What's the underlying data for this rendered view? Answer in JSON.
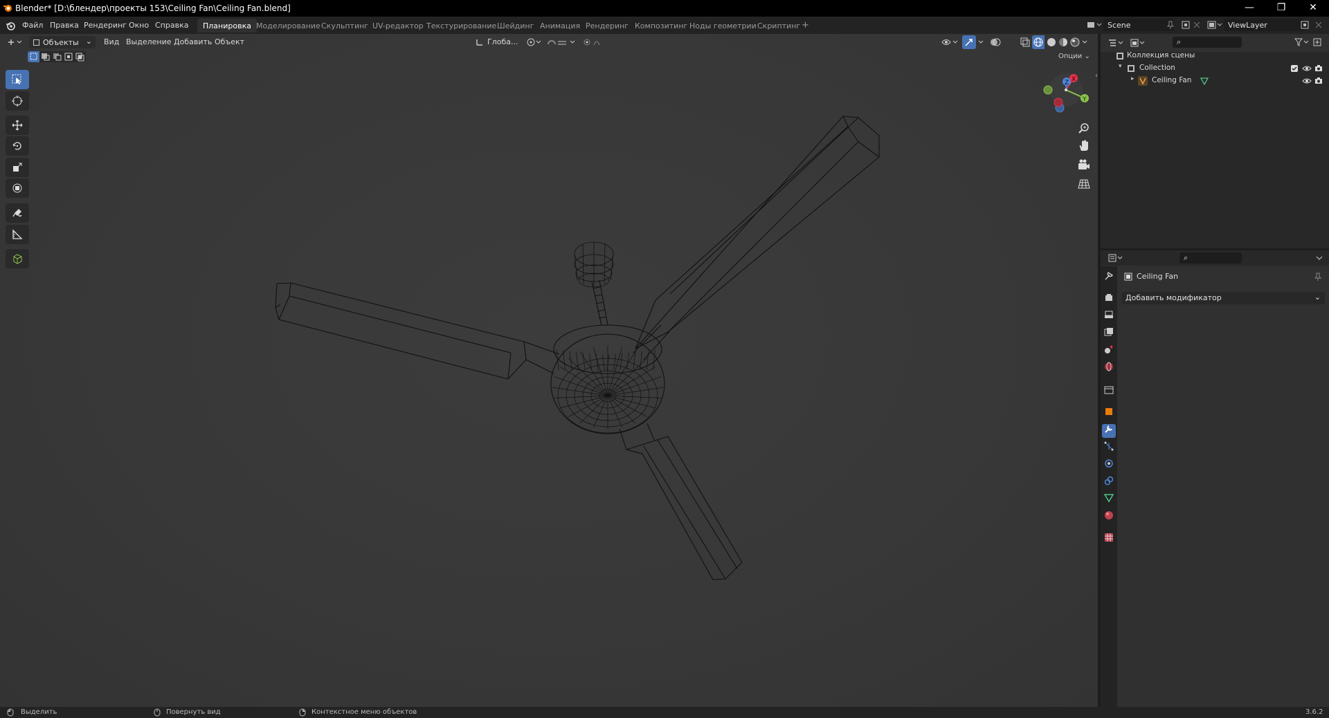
{
  "window": {
    "title": "Blender* [D:\\блендер\\проекты 153\\Ceiling Fan\\Ceiling Fan.blend]",
    "minimize": "—",
    "maximize": "❐",
    "close": "✕"
  },
  "menu": {
    "items": [
      "Файл",
      "Правка",
      "Рендеринг",
      "Окно",
      "Справка"
    ]
  },
  "workspaces": {
    "tabs": [
      "Планировка",
      "Моделирование",
      "Скульптинг",
      "UV-редактор",
      "Текстурирование",
      "Шейдинг",
      "Анимация",
      "Рендеринг",
      "Композитинг",
      "Ноды геометрии",
      "Скриптинг"
    ],
    "active": "Планировка",
    "add": "+"
  },
  "scene": {
    "label": "Scene"
  },
  "viewlayer": {
    "label": "ViewLayer"
  },
  "viewport": {
    "mode": "Объекты",
    "menus": [
      "Вид",
      "Выделение",
      "Добавить",
      "Объект"
    ],
    "orientation": "Глоба...",
    "options": "Опции",
    "gizmo": {
      "x": "X",
      "y": "Y",
      "z": "Z"
    }
  },
  "outliner": {
    "scene_collection": "Коллекция сцены",
    "collection": "Collection",
    "object": "Ceiling Fan"
  },
  "properties": {
    "object_name": "Ceiling Fan",
    "add_modifier": "Добавить модификатор"
  },
  "statusbar": {
    "select": "Выделить",
    "rotate": "Повернуть вид",
    "context_menu": "Контекстное меню объектов",
    "version": "3.6.2"
  },
  "colors": {
    "accent": "#4772b3",
    "axis_x": "#e2334a",
    "axis_y": "#8bc34a",
    "axis_z": "#4f86d8"
  }
}
